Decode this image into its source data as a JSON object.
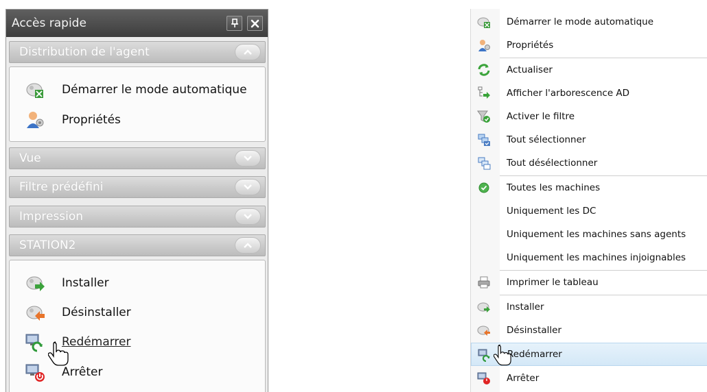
{
  "quick_access": {
    "title": "Accès rapide",
    "groups": [
      {
        "header": "Distribution de l'agent",
        "expanded": true,
        "items": [
          {
            "label": "Démarrer le mode automatique",
            "icon": "auto-mode-icon"
          },
          {
            "label": "Propriétés",
            "icon": "properties-icon"
          }
        ]
      },
      {
        "header": "Vue",
        "expanded": false
      },
      {
        "header": "Filtre prédéfini",
        "expanded": false
      },
      {
        "header": "Impression",
        "expanded": false
      },
      {
        "header": "STATION2",
        "expanded": true,
        "items": [
          {
            "label": "Installer",
            "icon": "install-icon"
          },
          {
            "label": "Désinstaller",
            "icon": "uninstall-icon"
          },
          {
            "label": "Redémarrer",
            "icon": "restart-icon",
            "hovered": true
          },
          {
            "label": "Arrêter",
            "icon": "shutdown-icon"
          }
        ]
      }
    ]
  },
  "context_menu": {
    "items": [
      {
        "label": "Démarrer le mode automatique",
        "icon": "auto-mode-icon"
      },
      {
        "label": "Propriétés",
        "icon": "properties-icon"
      },
      {
        "label": "Actualiser",
        "icon": "refresh-icon"
      },
      {
        "label": "Afficher l'arborescence AD",
        "icon": "ad-tree-icon"
      },
      {
        "label": "Activer le filtre",
        "icon": "filter-icon"
      },
      {
        "label": "Tout sélectionner",
        "icon": "select-all-icon"
      },
      {
        "label": "Tout désélectionner",
        "icon": "deselect-all-icon"
      },
      {
        "label": "Toutes les machines",
        "icon": "check-icon"
      },
      {
        "label": "Uniquement les DC",
        "icon": ""
      },
      {
        "label": "Uniquement les machines sans agents",
        "icon": ""
      },
      {
        "label": "Uniquement les machines injoignables",
        "icon": ""
      },
      {
        "label": "Imprimer le tableau",
        "icon": "printer-icon"
      },
      {
        "label": "Installer",
        "icon": "install-icon"
      },
      {
        "label": "Désinstaller",
        "icon": "uninstall-icon"
      },
      {
        "label": "Redémarrer",
        "icon": "restart-icon",
        "hovered": true
      },
      {
        "label": "Arrêter",
        "icon": "shutdown-icon"
      }
    ]
  },
  "colors": {
    "title_bar": "#4a4a4a",
    "group_header": "#c8c8c8",
    "menu_hover": "#d4e8f7"
  }
}
